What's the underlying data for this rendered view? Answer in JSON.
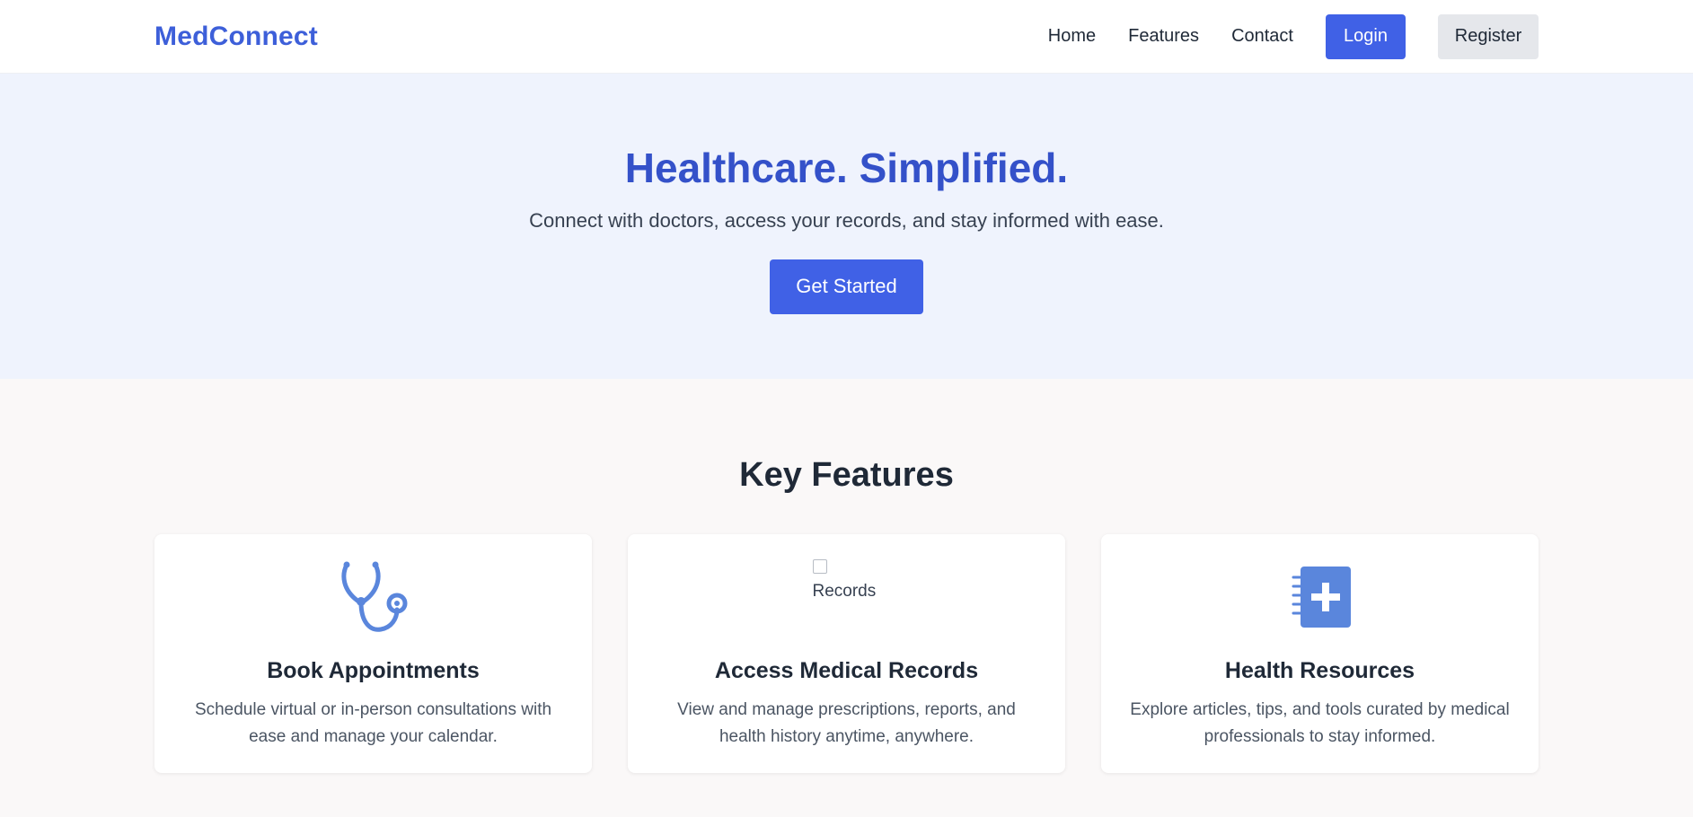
{
  "header": {
    "logo": "MedConnect",
    "nav": [
      "Home",
      "Features",
      "Contact"
    ],
    "login_label": "Login",
    "register_label": "Register"
  },
  "hero": {
    "title": "Healthcare. Simplified.",
    "subtitle": "Connect with doctors, access your records, and stay informed with ease.",
    "cta_label": "Get Started"
  },
  "features": {
    "title": "Key Features",
    "cards": [
      {
        "icon": "stethoscope-icon",
        "title": "Book Appointments",
        "description": "Schedule virtual or in-person consultations with ease and manage your calendar."
      },
      {
        "icon": "broken-image",
        "image_alt": "Records",
        "title": "Access Medical Records",
        "description": "View and manage prescriptions, reports, and health history anytime, anywhere."
      },
      {
        "icon": "medical-notebook-icon",
        "title": "Health Resources",
        "description": "Explore articles, tips, and tools curated by medical professionals to stay informed."
      }
    ]
  },
  "colors": {
    "brand": "#3d5fd9",
    "primary_button": "#4061e6",
    "hero_background": "#eff3fd",
    "icon": "#5a86dc"
  }
}
